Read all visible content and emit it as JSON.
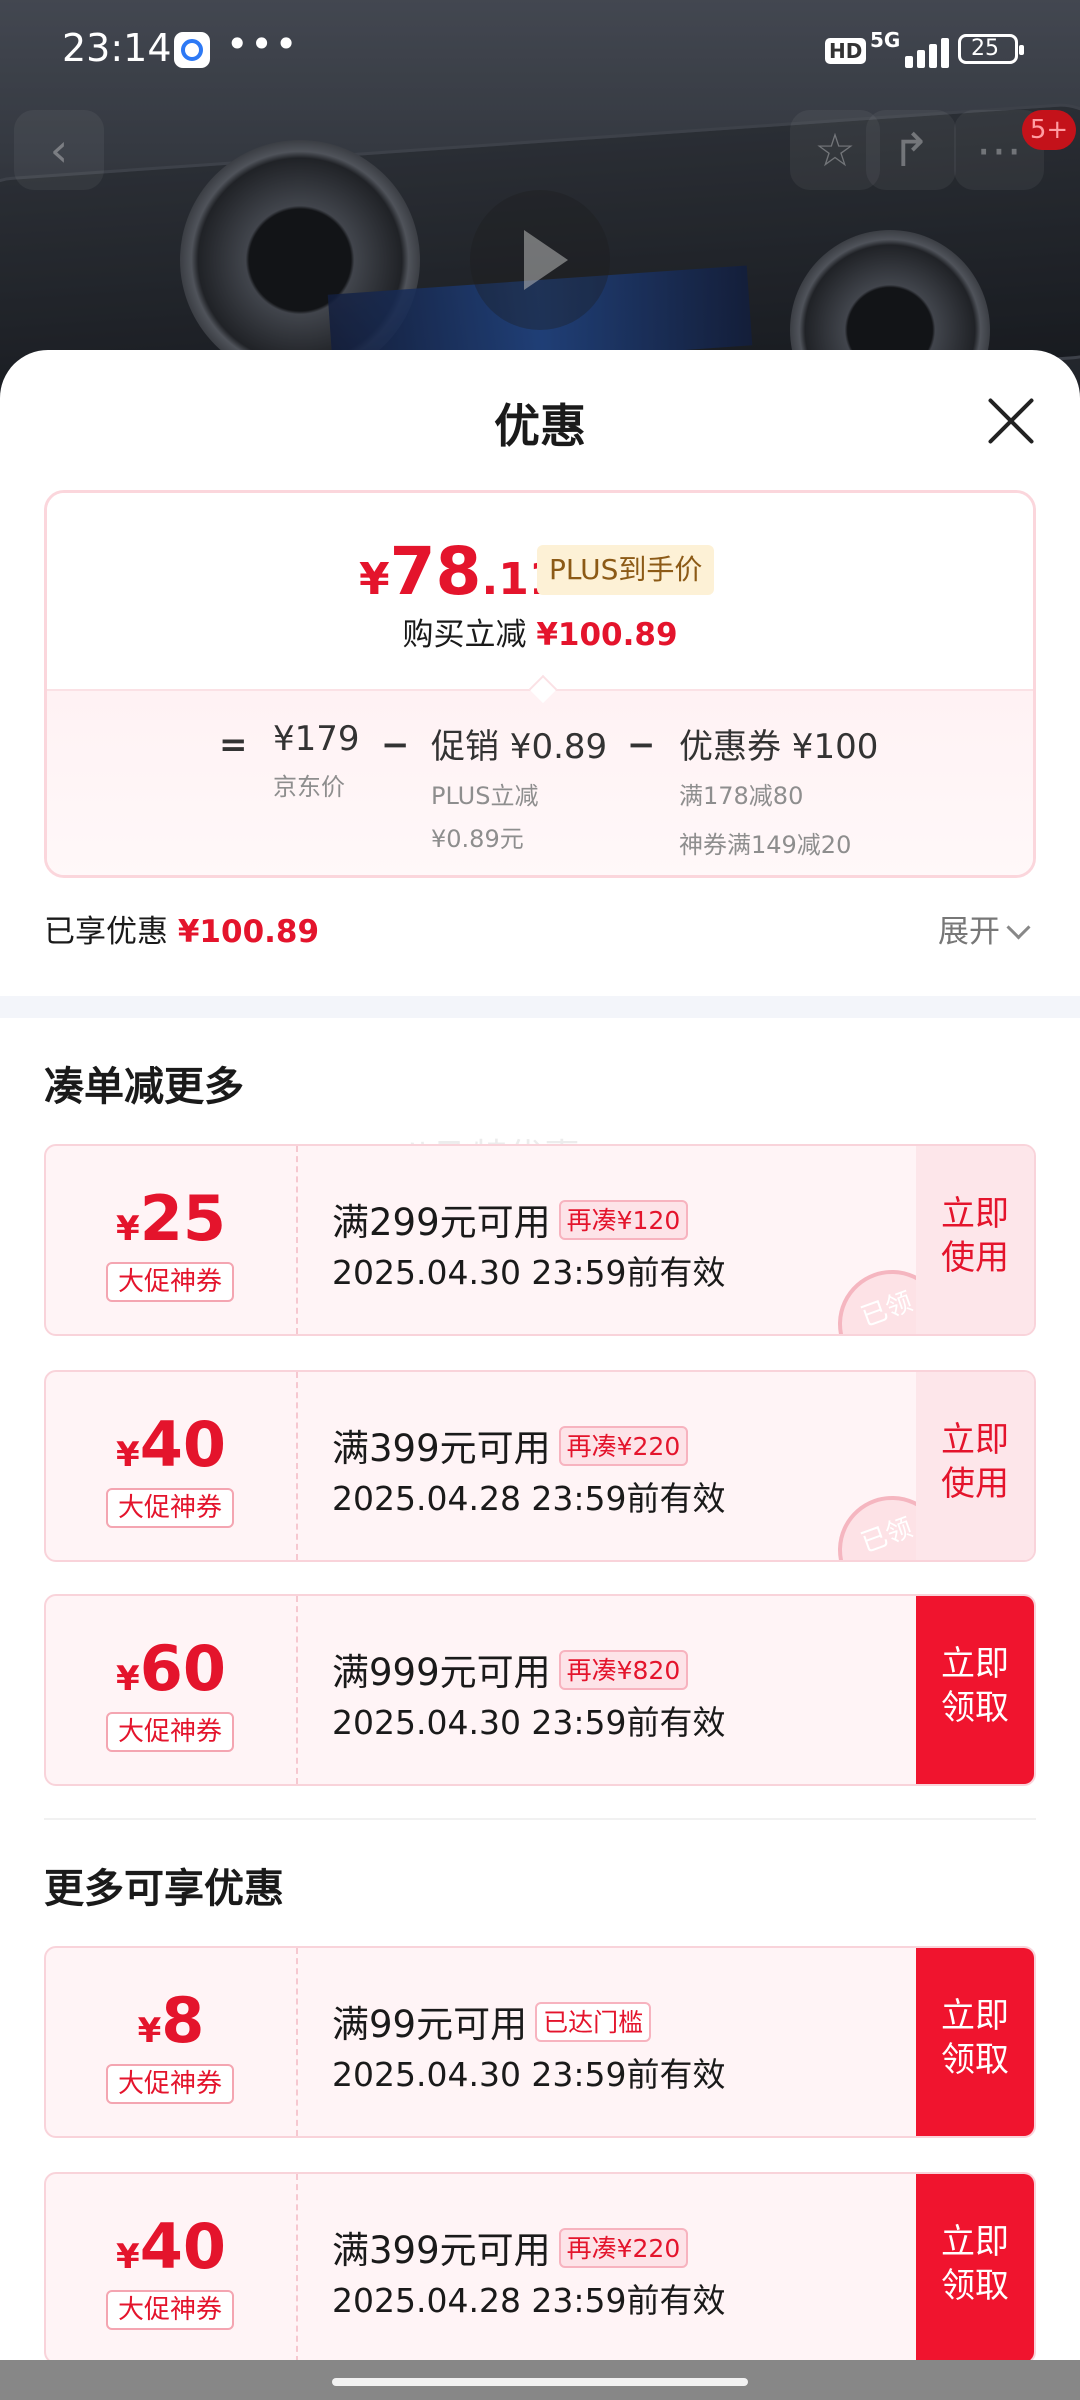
{
  "status_bar": {
    "time": "23:14",
    "more": "•••",
    "hd": "HD",
    "network": "5G",
    "battery": "25"
  },
  "header": {
    "cart_badge": "5+"
  },
  "sheet": {
    "title": "优惠"
  },
  "price_card": {
    "final_price": {
      "currency": "¥",
      "integer": "78",
      "decimal": ".11"
    },
    "plus_tag": "PLUS到手价",
    "reduce_label": "购买立减",
    "reduce_amount": "¥100.89",
    "breakdown": {
      "eq": "=",
      "minus": "−",
      "jd_price": {
        "value": "¥179",
        "label": "京东价"
      },
      "promo": {
        "value": "促销 ¥0.89",
        "sub1": "PLUS立减",
        "sub2": "¥0.89元"
      },
      "coupon": {
        "value": "优惠券 ¥100",
        "sub1": "满178减80",
        "sub2": "神券满149减20"
      }
    }
  },
  "enjoyed": {
    "label": "已享优惠",
    "amount": "¥100.89",
    "expand": "展开"
  },
  "sections": {
    "more_items": "凑单减更多",
    "more_offers": "更多可享优惠"
  },
  "watermark": "八飞特优惠",
  "coupons": [
    {
      "currency": "¥",
      "amount": "25",
      "tag": "大促神券",
      "condition": "满299元可用",
      "pill": "再凑¥120",
      "date": "2025.04.30 23:59前有效",
      "action_line1": "立即",
      "action_line2": "使用",
      "stamp": "已领"
    },
    {
      "currency": "¥",
      "amount": "40",
      "tag": "大促神券",
      "condition": "满399元可用",
      "pill": "再凑¥220",
      "date": "2025.04.28 23:59前有效",
      "action_line1": "立即",
      "action_line2": "使用",
      "stamp": "已领"
    },
    {
      "currency": "¥",
      "amount": "60",
      "tag": "大促神券",
      "condition": "满999元可用",
      "pill": "再凑¥820",
      "date": "2025.04.30 23:59前有效",
      "action_line1": "立即",
      "action_line2": "领取"
    },
    {
      "currency": "¥",
      "amount": "8",
      "tag": "大促神券",
      "condition": "满99元可用",
      "pill": "已达门槛",
      "date": "2025.04.30 23:59前有效",
      "action_line1": "立即",
      "action_line2": "领取"
    },
    {
      "currency": "¥",
      "amount": "40",
      "tag": "大促神券",
      "condition": "满399元可用",
      "pill": "再凑¥220",
      "date": "2025.04.28 23:59前有效",
      "action_line1": "立即",
      "action_line2": "领取"
    }
  ],
  "colors": {
    "accent": "#e4142c",
    "claim_bg": "#f0142e",
    "coupon_bg": "#fff4f6",
    "plus_tag_bg": "#fdf1d6"
  }
}
